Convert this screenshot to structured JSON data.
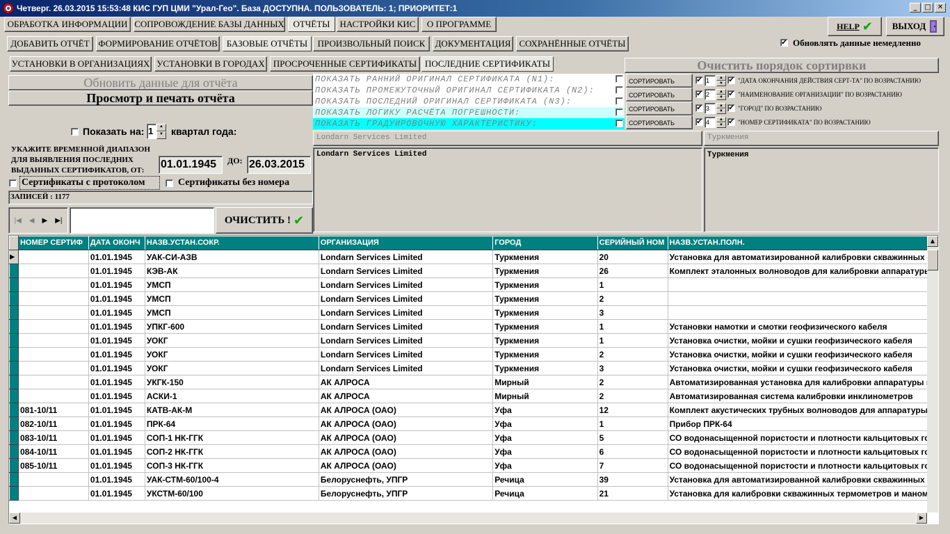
{
  "window": {
    "title": "Четверг. 26.03.2015 15:53:48 КИС ГУП ЦМИ \"Урал-Гео\". База ДОСТУПНА. ПОЛЬЗОВАТЕЛЬ: 1; ПРИОРИТЕТ:1"
  },
  "main_tabs": [
    "ОБРАБОТКА ИНФОРМАЦИИ",
    "СОПРОВОЖДЕНИЕ БАЗЫ ДАННЫХ",
    "ОТЧЁТЫ",
    "НАСТРОЙКИ КИС",
    "О ПРОГРАММЕ"
  ],
  "report_tabs": [
    "ДОБАВИТЬ ОТЧЁТ",
    "ФОРМИРОВАНИЕ ОТЧЁТОВ",
    "БАЗОВЫЕ ОТЧЁТЫ",
    "ПРОИЗВОЛЬНЫЙ ПОИСК",
    "ДОКУМЕНТАЦИЯ",
    "СОХРАНЁННЫЕ ОТЧЁТЫ"
  ],
  "base_tabs": [
    "УСТАНОВКИ В ОРГАНИЗАЦИЯХ",
    "УСТАНОВКИ В ГОРОДАХ",
    "ПРОСРОЧЕННЫЕ СЕРТИФИКАТЫ",
    "ПОСЛЕДНИЕ СЕРТИФИКАТЫ"
  ],
  "toolbar": {
    "help_label": "HELP",
    "exit_label": "ВЫХОД",
    "refresh_immediately": "Обновлять данные немедленно"
  },
  "left": {
    "refresh_report": "Обновить данные для отчёта",
    "preview_print": "Просмотр и печать отчёта",
    "show_on_label": "Показать на:",
    "quarter_value": "1",
    "quarter_suffix": "квартал года:",
    "range_label": "УКАЖИТЕ ВРЕМЕННОЙ ДИАПАЗОН ДЛЯ ВЫЯВЛЕНИЯ ПОСЛЕДНИХ ВЫДАННЫХ СЕРТИФИКАТОВ, ОТ:",
    "date_from": "01.01.1945",
    "to_label": "ДО:",
    "date_to": "26.03.2015",
    "with_protocol": "Сертификаты с протоколом",
    "without_number": "Сертификаты без номера",
    "records": "ЗАПИСЕЙ : 1177",
    "clear_label": "ОЧИСТИТЬ !"
  },
  "show_options": [
    "ПОКАЗАТЬ РАННИЙ ОРИГИНАЛ СЕРТИФИКАТА (N1):",
    "ПОКАЗАТЬ ПРОМЕЖУТОЧНЫЙ ОРИГИНАЛ СЕРТИФИКАТА (N2):",
    "ПОКАЗАТЬ ПОСЛЕДНИЙ ОРИГИНАЛ СЕРТИФИКАТА (N3):",
    "ПОКАЗАТЬ ЛОГИКУ РАСЧЁТА ПОГРЕШНОСТИ:",
    "ПОКАЗАТЬ ГРАДУИРОВОЧНУЮ ХАРАКТЕРИСТИКУ:"
  ],
  "sorting": {
    "clear_order": "Очистить порядок сортирвки",
    "rows": [
      {
        "label": "СОРТИРОВАТЬ",
        "num": "1",
        "desc": "\"ДАТА ОКОНЧАНИЯ ДЕЙСТВИЯ СЕРТ-ТА\" ПО ВОЗРАСТАНИЮ"
      },
      {
        "label": "СОРТИРОВАТЬ",
        "num": "2",
        "desc": "\"НАИМЕНОВАНИЕ ОРГАНИЗАЦИИ\" ПО ВОЗРАСТАНИЮ"
      },
      {
        "label": "СОРТИРОВАТЬ",
        "num": "3",
        "desc": "\"ГОРОД\" ПО ВОЗРАСТАНИЮ"
      },
      {
        "label": "СОРТИРОВАТЬ",
        "num": "4",
        "desc": "\"НОМЕР СЕРТИФИКАТА\" ПО ВОЗРАСТАНИЮ"
      }
    ]
  },
  "filters": {
    "org_combo": "Londarn Services Limited",
    "city_combo": "Туркмения",
    "org_list": "Londarn Services Limited",
    "city_list": "Туркмения"
  },
  "grid": {
    "columns": [
      "НОМЕР СЕРТИФ",
      "ДАТА ОКОНЧ",
      "НАЗВ.УСТАН.СОКР.",
      "ОРГАНИЗАЦИЯ",
      "ГОРОД",
      "СЕРИЙНЫЙ НОМ",
      "НАЗВ.УСТАН.ПОЛН."
    ],
    "rows": [
      [
        "",
        "01.01.1945",
        "УАК-СИ-АЗВ",
        "Londarn Services Limited",
        "Туркмения",
        "20",
        "Установка для автоматизированной калибровки скважинных и"
      ],
      [
        "",
        "01.01.1945",
        "КЭВ-АК",
        "Londarn Services Limited",
        "Туркмения",
        "26",
        "Комплект эталонных волноводов  для калибровки аппаратуры"
      ],
      [
        "",
        "01.01.1945",
        "УМСП",
        "Londarn Services Limited",
        "Туркмения",
        "1",
        ""
      ],
      [
        "",
        "01.01.1945",
        "УМСП",
        "Londarn Services Limited",
        "Туркмения",
        "2",
        ""
      ],
      [
        "",
        "01.01.1945",
        "УМСП",
        "Londarn Services Limited",
        "Туркмения",
        "3",
        ""
      ],
      [
        "",
        "01.01.1945",
        "УПКГ-600",
        "Londarn Services Limited",
        "Туркмения",
        "1",
        "Установки намотки и смотки геофизического кабеля"
      ],
      [
        "",
        "01.01.1945",
        "УОКГ",
        "Londarn Services Limited",
        "Туркмения",
        "1",
        "Установка очистки, мойки и сушки геофизического кабеля"
      ],
      [
        "",
        "01.01.1945",
        "УОКГ",
        "Londarn Services Limited",
        "Туркмения",
        "2",
        "Установка очистки, мойки и сушки геофизического кабеля"
      ],
      [
        "",
        "01.01.1945",
        "УОКГ",
        "Londarn Services Limited",
        "Туркмения",
        "3",
        "Установка очистки, мойки и сушки геофизического кабеля"
      ],
      [
        "",
        "01.01.1945",
        "УКГК-150",
        "АК АЛРОСА",
        "Мирный",
        "2",
        "Автоматизированная установка для калибровки аппаратуры га"
      ],
      [
        "",
        "01.01.1945",
        "АСКИ-1",
        "АК АЛРОСА",
        "Мирный",
        "2",
        "Автоматизированная система калибровки инклинометров"
      ],
      [
        "081-10/11",
        "01.01.1945",
        "КАТВ-АК-М",
        "АК АЛРОСА (ОАО)",
        "Уфа",
        "12",
        "Комплект акустических трубных волноводов для аппаратуры А"
      ],
      [
        "082-10/11",
        "01.01.1945",
        "ПРК-64",
        "АК АЛРОСА (ОАО)",
        "Уфа",
        "1",
        "Прибор ПРК-64"
      ],
      [
        "083-10/11",
        "01.01.1945",
        "СОП-1 НК-ГГК",
        "АК АЛРОСА (ОАО)",
        "Уфа",
        "5",
        "СО водонасыщенной пористости и плотности кальцитовых гор"
      ],
      [
        "084-10/11",
        "01.01.1945",
        "СОП-2 НК-ГГК",
        "АК АЛРОСА (ОАО)",
        "Уфа",
        "6",
        "СО водонасыщенной пористости и плотности кальцитовых гор"
      ],
      [
        "085-10/11",
        "01.01.1945",
        "СОП-3 НК-ГГК",
        "АК АЛРОСА (ОАО)",
        "Уфа",
        "7",
        "СО водонасыщенной пористости и плотности кальцитовых гор"
      ],
      [
        "",
        "01.01.1945",
        "УАК-СТМ-60/100-4",
        "Белоруснефть, УПГР",
        "Речица",
        "39",
        "Установка для автоматизированной калибровки скважинных т"
      ],
      [
        "",
        "01.01.1945",
        "УКСТМ-60/100",
        "Белоруснефть, УПГР",
        "Речица",
        "21",
        "Установка для калибровки скважинных термометров и маноме"
      ]
    ]
  },
  "colors": {
    "accent": "#008080",
    "title_bar": "#0a246a",
    "highlight_cyan": "#00ffff",
    "highlight_light": "#ccffff"
  }
}
